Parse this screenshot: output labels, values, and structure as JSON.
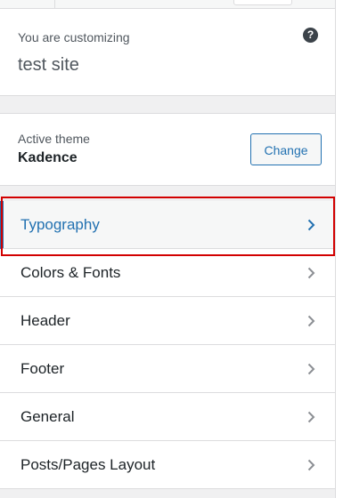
{
  "header": {
    "customizing_prefix": "You are customizing",
    "site_title": "test site",
    "help_icon": "question-mark-icon"
  },
  "theme": {
    "label": "Active theme",
    "name": "Kadence",
    "change_label": "Change"
  },
  "menu": {
    "items": [
      {
        "label": "Typography",
        "active": true
      },
      {
        "label": "Colors & Fonts",
        "active": false
      },
      {
        "label": "Header",
        "active": false
      },
      {
        "label": "Footer",
        "active": false
      },
      {
        "label": "General",
        "active": false
      },
      {
        "label": "Posts/Pages Layout",
        "active": false
      }
    ],
    "chevron_icon": "chevron-right-icon"
  },
  "colors": {
    "accent": "#2271b1",
    "highlight": "#d20000",
    "text": "#1d2327",
    "muted_text": "#50575e",
    "chevron": "#8c8f94"
  }
}
